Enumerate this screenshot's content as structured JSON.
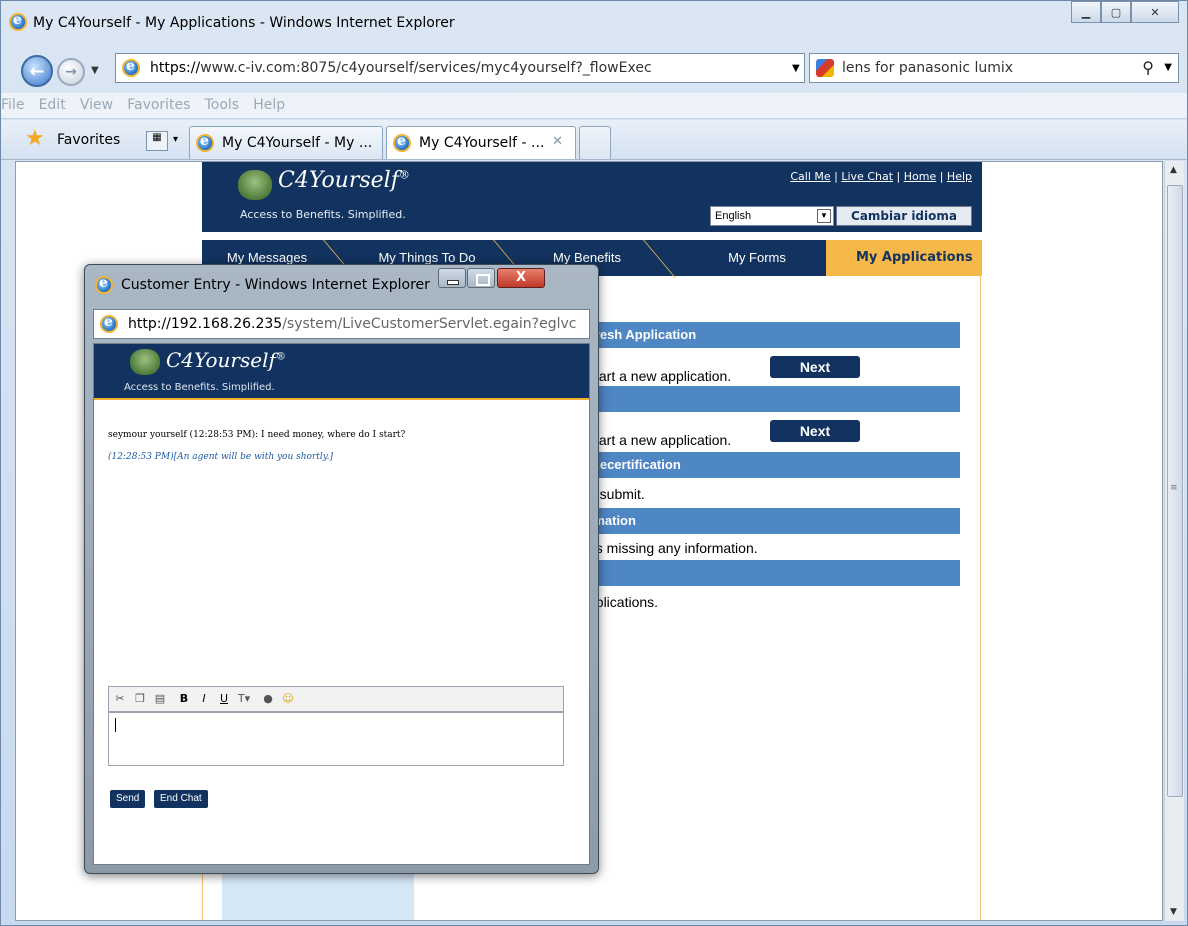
{
  "window": {
    "title": "My C4Yourself - My Applications - Windows Internet Explorer",
    "address": {
      "scheme": "https://",
      "host_path": "www.c-iv.com:8075/c4yourself/services/myc4yourself?_flowExec"
    },
    "search_query": "lens for panasonic lumix",
    "menu": [
      "File",
      "Edit",
      "View",
      "Favorites",
      "Tools",
      "Help"
    ],
    "favorites_label": "Favorites",
    "tabs": [
      {
        "label": "My C4Yourself - My ..."
      },
      {
        "label": "My C4Yourself - ..."
      }
    ]
  },
  "page": {
    "brand": "C4Yourself",
    "registered": "®",
    "tagline": "Access to Benefits. Simplified.",
    "header_links": [
      "Call Me",
      "Live Chat",
      "Home",
      "Help"
    ],
    "language_value": "English",
    "language_button": "Cambiar idioma",
    "nav_tabs": [
      "My Messages",
      "My Things To Do",
      "My Benefits",
      "My Forms",
      "My Applications"
    ],
    "sections": [
      {
        "bar": "alFresh Application",
        "text": "start a new application.",
        "button": "Next"
      },
      {
        "bar": "",
        "text": "start a new application.",
        "button": "Next"
      },
      {
        "bar": "al/Recertification",
        "text": "o submit."
      },
      {
        "bar": "formation",
        "text": "ns missing any information."
      },
      {
        "bar": "",
        "text": "pplications."
      }
    ]
  },
  "popup": {
    "title": "Customer Entry - Windows Internet Explorer",
    "address": {
      "host": "http://192.168.26.235",
      "path": "/system/LiveCustomerServlet.egain?eglvc"
    },
    "brand": "C4Yourself",
    "registered": "®",
    "tagline": "Access to Benefits. Simplified.",
    "messages": [
      "seymour yourself (12:28:53 PM): I need money, where do I start?",
      "(12:28:53 PM)[An agent will be with you shortly.]"
    ],
    "toolbar_icons": [
      "cut-icon",
      "copy-icon",
      "paste-icon",
      "bold-icon",
      "italic-icon",
      "underline-icon",
      "font-size-icon",
      "insert-link-icon",
      "smiley-icon"
    ],
    "bold_label": "B",
    "italic_label": "I",
    "underline_label": "U",
    "send_label": "Send",
    "end_chat_label": "End Chat"
  },
  "colors": {
    "brand_navy": "#12335f",
    "accent_orange": "#f7b84a",
    "section_blue": "#4f86c4"
  }
}
